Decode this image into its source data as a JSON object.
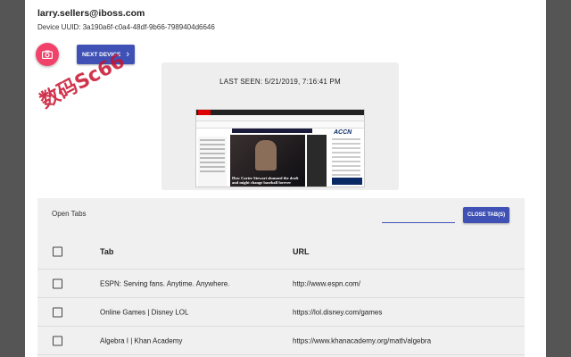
{
  "user": {
    "email": "larry.sellers@iboss.com",
    "device_uuid_label": "Device UUID:",
    "device_uuid": "3a190a6f-c0a4-48df-9b66-7989404d6646"
  },
  "actions": {
    "next_device_label": "NEXT DEVICE",
    "close_tabs_label": "CLOSE TAB(S)"
  },
  "icons": {
    "camera": "camera-icon",
    "next": "chevron-right-icon"
  },
  "colors": {
    "primary": "#3f51b5",
    "fab": "#f2426a",
    "watermark": "#c8102e"
  },
  "watermark_text": "数码Sc66",
  "last_seen": {
    "label": "LAST SEEN: 5/21/2019, 7:16:41 PM",
    "screenshot_caption": "How Carter Stewart shunned the draft and might change baseball forever",
    "screenshot_brand": "ACCN",
    "screenshot_site": "ESPN"
  },
  "tabs_panel": {
    "title": "Open Tabs",
    "search_value": "",
    "columns": {
      "tab": "Tab",
      "url": "URL"
    },
    "rows": [
      {
        "tab": "ESPN: Serving fans. Anytime. Anywhere.",
        "url": "http://www.espn.com/"
      },
      {
        "tab": "Online Games | Disney LOL",
        "url": "https://lol.disney.com/games"
      },
      {
        "tab": "Algebra I | Khan Academy",
        "url": "https://www.khanacademy.org/math/algebra"
      }
    ]
  }
}
